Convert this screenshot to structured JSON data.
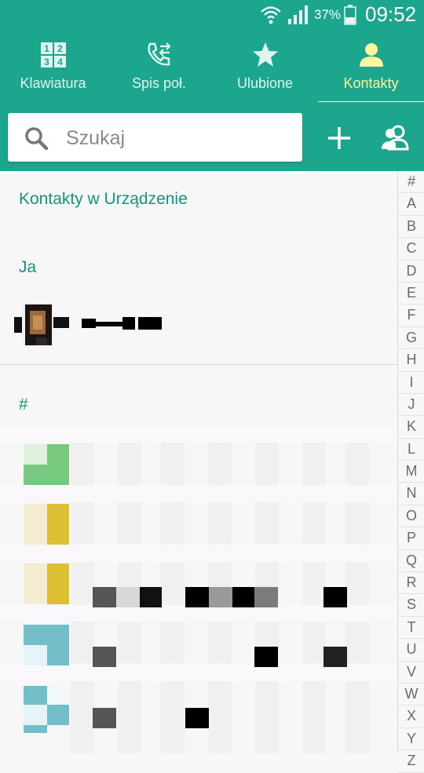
{
  "status_bar": {
    "battery": "37%",
    "time": "09:52",
    "icons": [
      "wifi-icon",
      "signal-icon",
      "battery-icon"
    ]
  },
  "tabs": [
    {
      "label": "Klawiatura",
      "icon": "dialpad-icon",
      "active": false
    },
    {
      "label": "Spis poł.",
      "icon": "call-log-icon",
      "active": false
    },
    {
      "label": "Ulubione",
      "icon": "star-icon",
      "active": false
    },
    {
      "label": "Kontakty",
      "icon": "person-icon",
      "active": true
    }
  ],
  "search": {
    "placeholder": "Szukaj"
  },
  "actions": {
    "add": "add-icon",
    "groups": "groups-icon"
  },
  "list": {
    "section_title": "Kontakty w Urządzenie",
    "me_header": "Ja",
    "hash_header": "#"
  },
  "alphabet": [
    "#",
    "A",
    "B",
    "C",
    "D",
    "E",
    "F",
    "G",
    "H",
    "I",
    "J",
    "K",
    "L",
    "M",
    "N",
    "O",
    "P",
    "Q",
    "R",
    "S",
    "T",
    "U",
    "V",
    "W",
    "X",
    "Y",
    "Z"
  ],
  "colors": {
    "primary": "#1ba68d",
    "accent_tab": "#fff59a",
    "section_text": "#14937d",
    "avatar_green": "#77c97f",
    "avatar_yellow": "#dcbf33",
    "avatar_teal": "#74bec9"
  }
}
